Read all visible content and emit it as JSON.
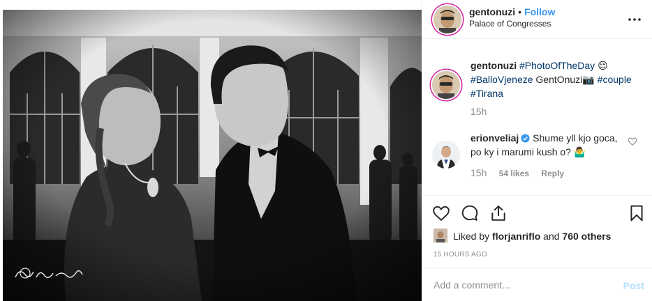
{
  "header": {
    "username": "gentonuzi",
    "separator": "•",
    "follow_label": "Follow",
    "location": "Palace of Congresses",
    "more_icon": "more-horizontal-icon"
  },
  "caption": {
    "username": "gentonuzi",
    "tag_photo": "#PhotoOfTheDay",
    "emoji": "😌",
    "tag_ballo": "#BalloVjeneze",
    "photographer": "GentOnuzi",
    "camera_emoji": "📷",
    "tag_couple": "#couple",
    "tag_tirana": "#Tirana",
    "time": "15h"
  },
  "comment": {
    "username": "erionveliaj",
    "text": "Shume yll kjo goca, po ky i marumi kush o? 🤷‍♂️",
    "time": "15h",
    "likes": "54 likes",
    "reply": "Reply"
  },
  "actions": {
    "icons": [
      "heart-icon",
      "comment-icon",
      "share-icon",
      "bookmark-icon"
    ]
  },
  "likes": {
    "prefix": "Liked by",
    "user": "florjanriflo",
    "middle": "and",
    "others": "760 others"
  },
  "timestamp": "15 HOURS AGO",
  "comment_box": {
    "placeholder": "Add a comment...",
    "post_label": "Post"
  },
  "colors": {
    "link_blue": "#3897f0",
    "hashtag_blue": "#003569",
    "muted": "#8e8e8e",
    "post_disabled": "#b2dffc"
  }
}
